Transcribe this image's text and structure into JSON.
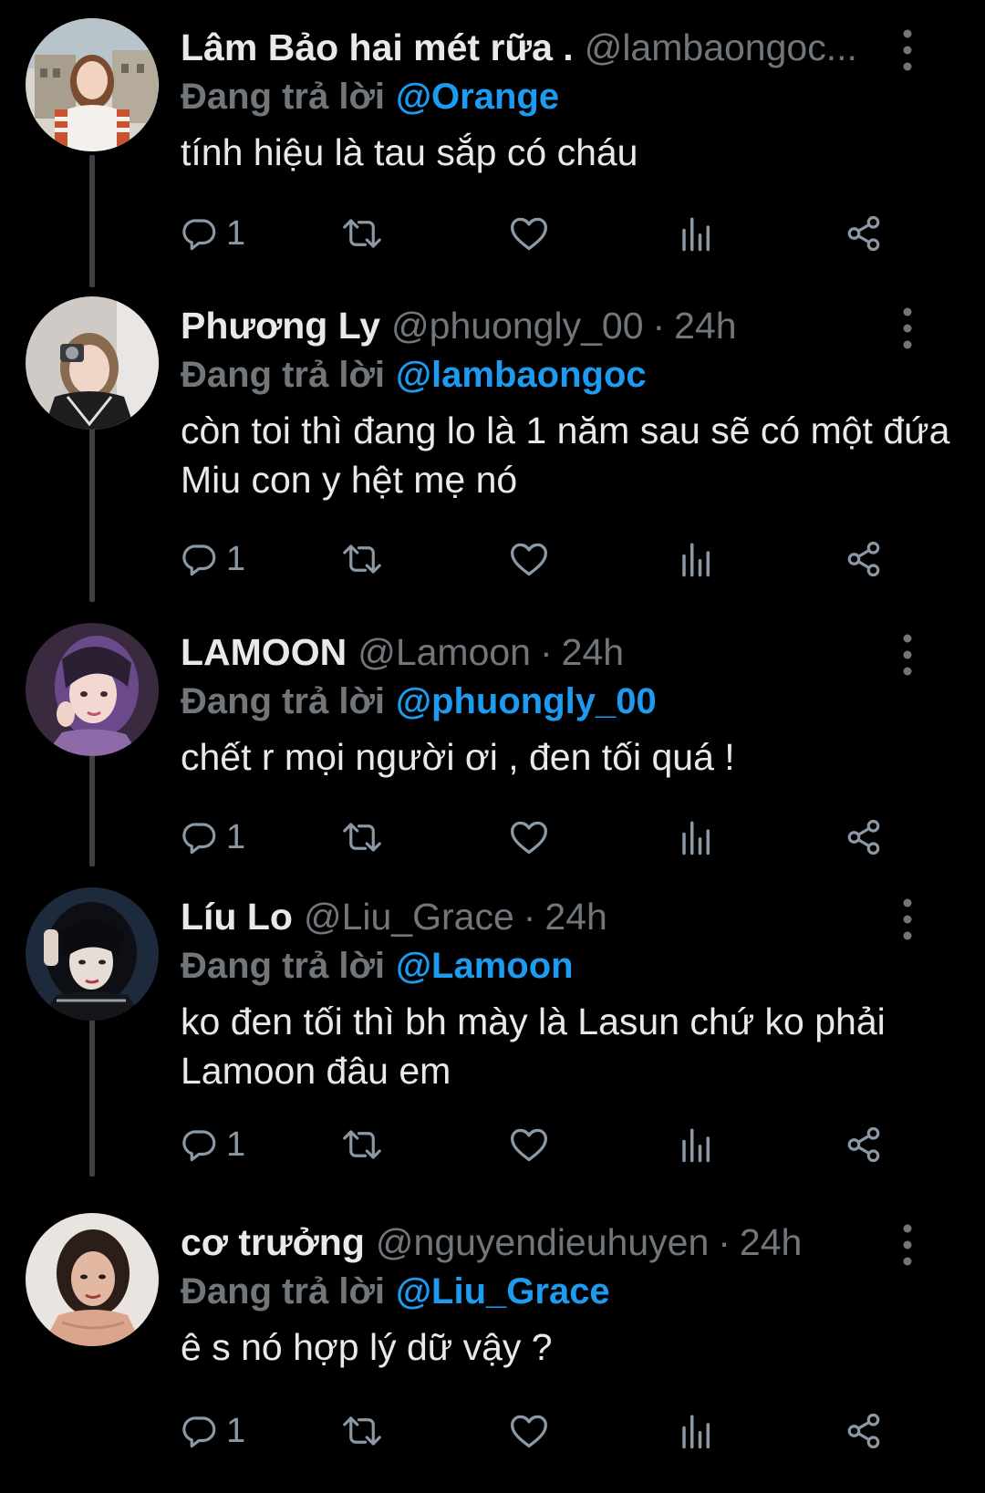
{
  "reply_prefix": "Đang trả lời",
  "separator": "·",
  "colors": {
    "background": "#000000",
    "text": "#e7e9ea",
    "muted": "#71767b",
    "accent": "#1d9bf0",
    "thread_line": "#3e4144"
  },
  "icons": [
    "reply-icon",
    "retweet-icon",
    "like-icon",
    "views-icon",
    "share-icon",
    "more-icon"
  ],
  "tweets": [
    {
      "name": "Lâm Bảo hai mét rữa .",
      "handle": "@lambaongoc...",
      "time": "",
      "reply_to": "@Orange",
      "text": "tính hiệu là tau sắp có cháu",
      "reply_count": "1"
    },
    {
      "name": "Phương Ly",
      "handle": "@phuongly_00",
      "time": "24h",
      "reply_to": "@lambaongoc",
      "text": "còn toi thì đang lo là 1 năm sau sẽ có một đứa Miu con y hệt mẹ nó",
      "reply_count": "1"
    },
    {
      "name": "LAMOON",
      "handle": "@Lamoon",
      "time": "24h",
      "reply_to": "@phuongly_00",
      "text": "chết r mọi người ơi , đen tối quá !",
      "reply_count": "1"
    },
    {
      "name": "Líu Lo",
      "handle": "@Liu_Grace",
      "time": "24h",
      "reply_to": "@Lamoon",
      "text": "ko đen tối thì bh mày là Lasun chứ ko phải Lamoon đâu em",
      "reply_count": "1"
    },
    {
      "name": "cơ trưởng",
      "handle": "@nguyendieuhuyen",
      "time": "24h",
      "reply_to": "@Liu_Grace",
      "text": "ê s nó hợp lý dữ vậy ?",
      "reply_count": "1"
    }
  ]
}
